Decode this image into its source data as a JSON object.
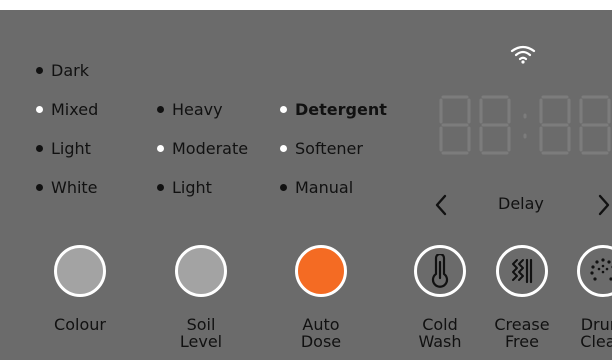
{
  "options": {
    "col1": [
      "Dark",
      "Mixed",
      "Light",
      "White"
    ],
    "col2": [
      "Heavy",
      "Moderate",
      "Light"
    ],
    "col3": [
      "Detergent",
      "Softener",
      "Manual"
    ]
  },
  "delay_label": "Delay",
  "buttons": {
    "colour": {
      "label_line1": "Colour",
      "label_line2": ""
    },
    "soil_level": {
      "label_line1": "Soil",
      "label_line2": "Level"
    },
    "auto_dose": {
      "label_line1": "Auto",
      "label_line2": "Dose"
    },
    "cold_wash": {
      "label_line1": "Cold",
      "label_line2": "Wash"
    },
    "crease_free": {
      "label_line1": "Crease",
      "label_line2": "Free"
    },
    "drum_clean": {
      "label_line1": "Drum",
      "label_line2": "Clean"
    }
  },
  "display_value": "88:88",
  "colors": {
    "panel": "#6b6b6b",
    "knob_gray": "#a3a3a3",
    "accent_orange": "#f46b23",
    "lit_text": "#ffffff",
    "unlit_text": "#111111"
  },
  "icons": {
    "wifi": "wifi-icon",
    "prev": "chevron-left-icon",
    "next": "chevron-right-icon",
    "cold_wash": "thermometer-icon",
    "crease_free": "crease-free-icon",
    "drum_clean": "drum-clean-icon"
  }
}
